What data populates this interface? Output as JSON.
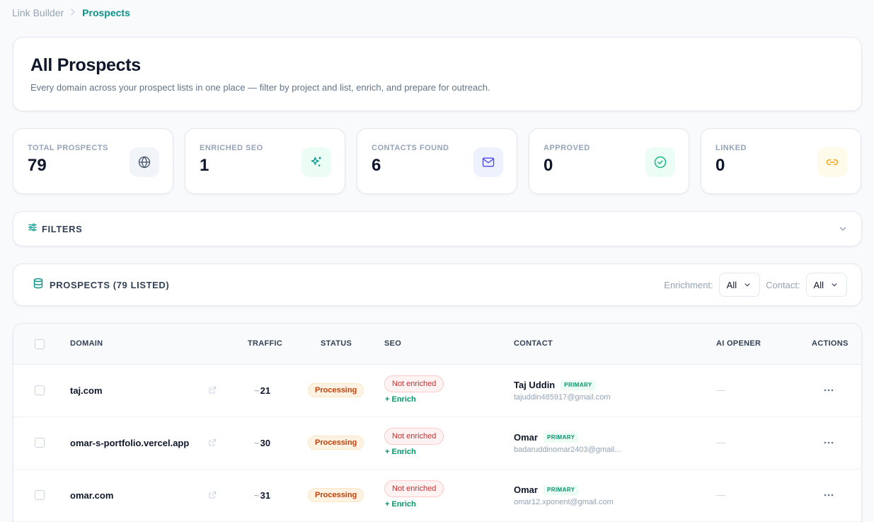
{
  "breadcrumb": {
    "root": "Link Builder",
    "current": "Prospects"
  },
  "header": {
    "title": "All Prospects",
    "subtitle": "Every domain across your prospect lists in one place — filter by project and list, enrich, and prepare for outreach."
  },
  "stats": [
    {
      "label": "TOTAL PROSPECTS",
      "value": "79",
      "icon": "globe-icon",
      "icon_bg": "#f1f5f9",
      "icon_color": "#475569"
    },
    {
      "label": "ENRICHED SEO",
      "value": "1",
      "icon": "sparkles-icon",
      "icon_bg": "#ecfdf5",
      "icon_color": "#0d9488"
    },
    {
      "label": "CONTACTS FOUND",
      "value": "6",
      "icon": "mail-icon",
      "icon_bg": "#eef2ff",
      "icon_color": "#4f46e5"
    },
    {
      "label": "APPROVED",
      "value": "0",
      "icon": "check-circle-icon",
      "icon_bg": "#ecfdf5",
      "icon_color": "#10b981"
    },
    {
      "label": "LINKED",
      "value": "0",
      "icon": "link-icon",
      "icon_bg": "#fffbeb",
      "icon_color": "#f59e0b"
    }
  ],
  "filters": {
    "title": "FILTERS"
  },
  "prospects": {
    "title": "PROSPECTS (79 LISTED)",
    "enrichment_label": "Enrichment:",
    "enrichment_value": "All",
    "contact_label": "Contact:",
    "contact_value": "All"
  },
  "table": {
    "columns": [
      "DOMAIN",
      "TRAFFIC",
      "STATUS",
      "SEO",
      "CONTACT",
      "AI OPENER",
      "ACTIONS"
    ],
    "rows": [
      {
        "domain": "taj.com",
        "traffic_prefix": "~",
        "traffic": "21",
        "status": "Processing",
        "seo": "Not enriched",
        "enrich": "+ Enrich",
        "contact_name": "Taj Uddin",
        "contact_badge": "PRIMARY",
        "contact_email": "tajuddin485917@gmail.com",
        "ai_opener": "—"
      },
      {
        "domain": "omar-s-portfolio.vercel.app",
        "traffic_prefix": "~",
        "traffic": "30",
        "status": "Processing",
        "seo": "Not enriched",
        "enrich": "+ Enrich",
        "contact_name": "Omar",
        "contact_badge": "PRIMARY",
        "contact_email": "badaruddinomar2403@gmail...",
        "ai_opener": "—"
      },
      {
        "domain": "omar.com",
        "traffic_prefix": "~",
        "traffic": "31",
        "status": "Processing",
        "seo": "Not enriched",
        "enrich": "+ Enrich",
        "contact_name": "Omar",
        "contact_badge": "PRIMARY",
        "contact_email": "omar12.xponent@gmail.com",
        "ai_opener": "—"
      }
    ]
  },
  "colors": {
    "accent": "#0d9488",
    "processing": "#c2410c",
    "not_enriched": "#dc2626",
    "enrich": "#059669"
  }
}
